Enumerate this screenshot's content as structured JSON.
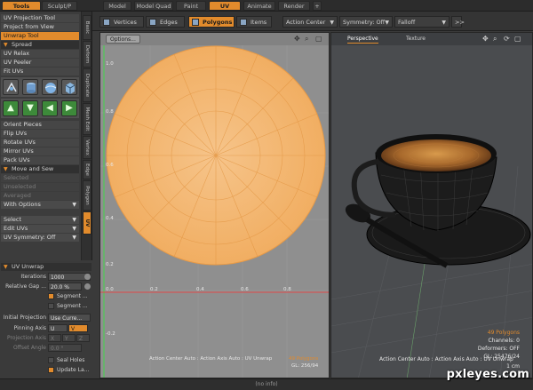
{
  "top_tabs": [
    "Tools",
    "Sculpt/P",
    "Model",
    "Model Quad",
    "Paint",
    "UV",
    "Animate",
    "Render"
  ],
  "active_top_tab": "UV",
  "left_panel": {
    "tool_items": [
      "UV Projection Tool",
      "Project from View",
      "Unwrap Tool"
    ],
    "highlighted_item": "Unwrap Tool",
    "spread_section": "Spread",
    "spread_items": [
      "UV Relax",
      "UV Peeler",
      "Fit UVs"
    ],
    "orient_items": [
      "Orient Pieces",
      "Flip UVs",
      "Rotate UVs",
      "Mirror UVs",
      "Pack UVs"
    ],
    "move_section": "Move and Sew",
    "dim_items": [
      "Selected",
      "Unselected",
      "Averaged"
    ],
    "with_options": "With Options",
    "select_drop": "Select",
    "edit_uvs_drop": "Edit UVs",
    "uv_symmetry_drop": "UV Symmetry: Off"
  },
  "vertical_tabs": [
    "Basic",
    "Deform",
    "Duplicate",
    "Mesh Edit",
    "Vertex",
    "Edge",
    "Polygon",
    "UV"
  ],
  "active_vertical_tab": "UV",
  "uv_unwrap": {
    "header": "UV Unwrap",
    "iterations_label": "Iterations",
    "iterations_value": "1000",
    "relative_gap_label": "Relative Gap ...",
    "relative_gap_value": "20.0 %",
    "segment1": "Segment ...",
    "segment2": "Segment ...",
    "initial_projection_label": "Initial Projection",
    "initial_projection_value": "Use Curre...",
    "pinning_axis_label": "Pinning Axis",
    "pinning_u": "U",
    "pinning_v": "V",
    "projection_axis_label": "Projection Axis",
    "projection_axis_values": [
      "X",
      "Y",
      "Z"
    ],
    "offset_angle_label": "Offset Angle",
    "offset_angle_value": "0.0 °",
    "seal_holes": "Seal Holes",
    "update_label": "Update La..."
  },
  "toolbar": {
    "vertices": "Vertices",
    "edges": "Edges",
    "polygons": "Polygons",
    "items": "Items",
    "action_center": "Action Center",
    "symmetry": "Symmetry: Off",
    "falloff": "Falloff",
    "more": ">>"
  },
  "uv_viewport": {
    "options": "Options...",
    "axis_labels_v": [
      "1.0",
      "0.8",
      "0.6",
      "0.4",
      "0.2",
      "0.0",
      "-0.2"
    ],
    "axis_labels_u": [
      "0.2",
      "0.4",
      "0.6",
      "0.8",
      "1.0"
    ],
    "status_line": "Action Center Auto : Action Axis Auto : UV Unwrap",
    "polygons": "49 Polygons",
    "gl": "GL: 256/94"
  },
  "viewport_3d": {
    "perspective": "Perspective",
    "texture": "Texture",
    "polygons": "49 Polygons",
    "channels": "Channels: 0",
    "deformers": "Deformers: OFF",
    "gl": "GL: 25476/24",
    "scale": "1 cm",
    "status_line": "Action Center Auto : Action Axis Auto : UV Unwrap"
  },
  "status_bar": "(no info)",
  "watermark": "pxleyes.com",
  "colors": {
    "accent": "#e28b2c",
    "uv_fill": "#f2b26b",
    "panel": "#3c3c3c",
    "uv_background": "#8f8f8f"
  }
}
